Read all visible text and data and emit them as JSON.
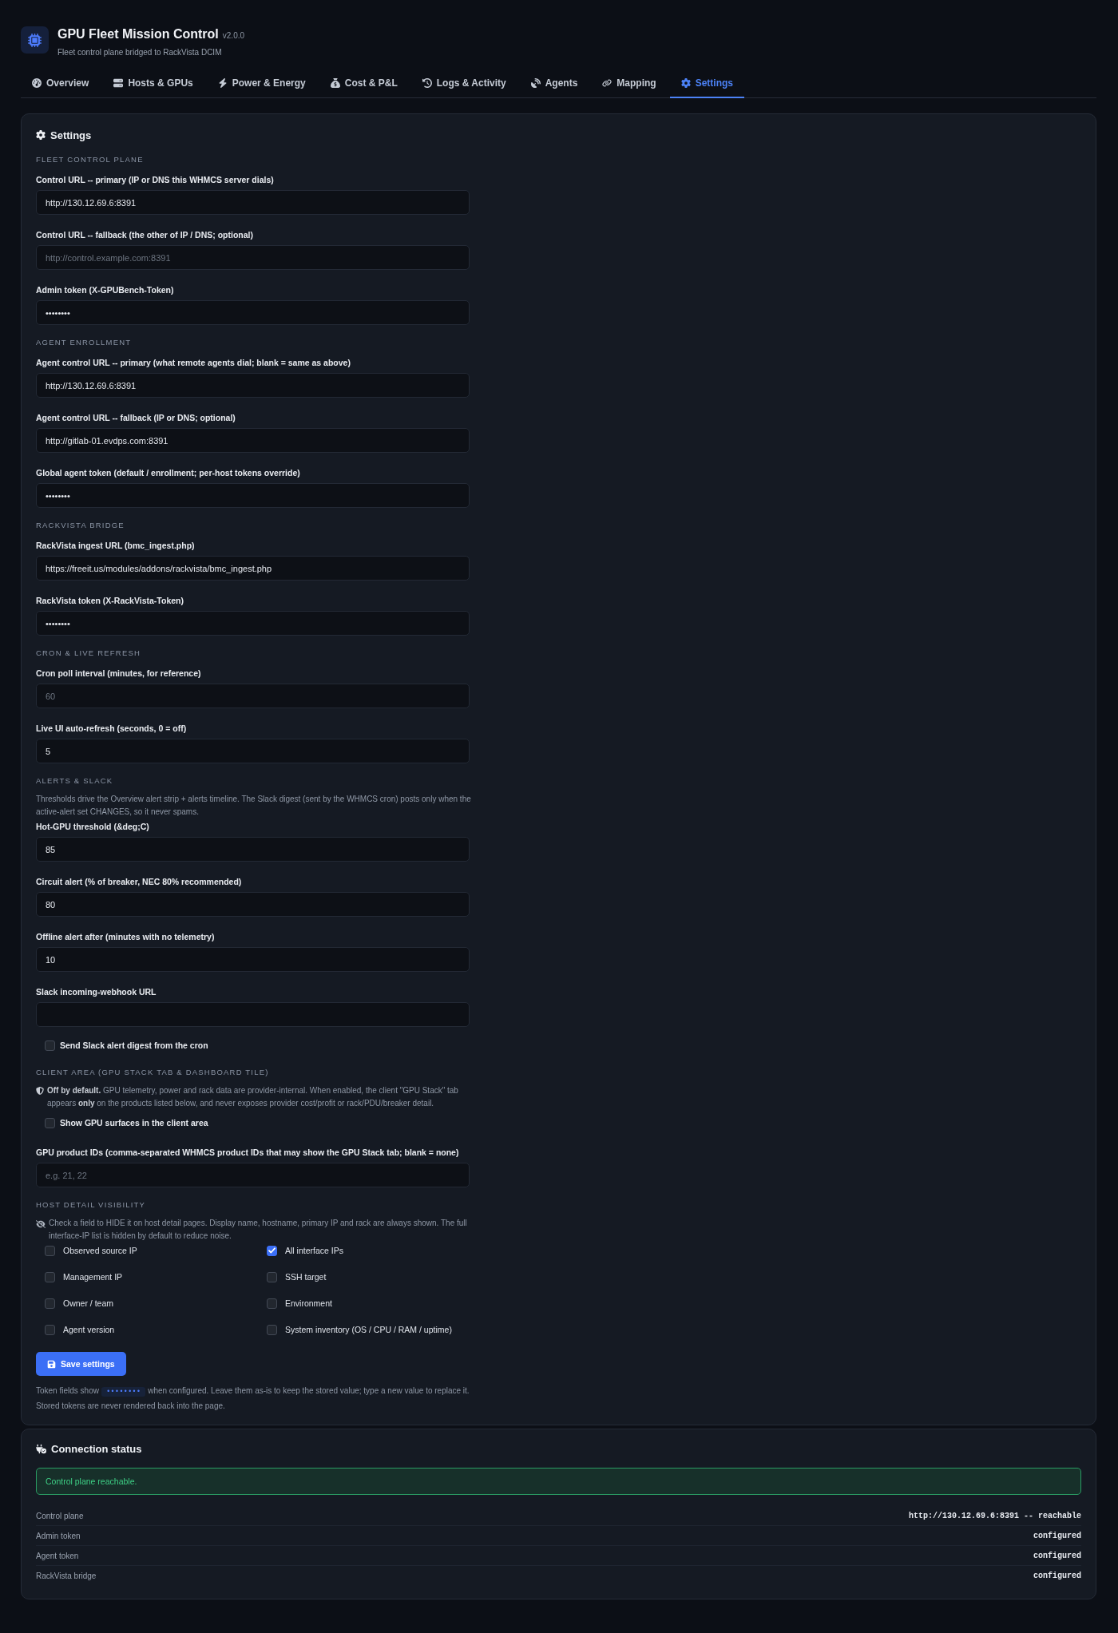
{
  "header": {
    "title": "GPU Fleet Mission Control",
    "version": "v2.0.0",
    "subtitle": "Fleet control plane bridged to RackVista DCIM"
  },
  "tabs": [
    {
      "label": "Overview",
      "selected": false
    },
    {
      "label": "Hosts & GPUs",
      "selected": false
    },
    {
      "label": "Power & Energy",
      "selected": false
    },
    {
      "label": "Cost & P&L",
      "selected": false
    },
    {
      "label": "Logs & Activity",
      "selected": false
    },
    {
      "label": "Agents",
      "selected": false
    },
    {
      "label": "Mapping",
      "selected": false
    },
    {
      "label": "Settings",
      "selected": true
    }
  ],
  "settings": {
    "title": "Settings",
    "sections": [
      {
        "heading": "FLEET CONTROL PLANE",
        "items": [
          {
            "kind": "field",
            "label": "Control URL -- primary (IP or DNS this WHMCS server dials)",
            "value": "http://130.12.69.6:8391"
          },
          {
            "kind": "field",
            "label": "Control URL -- fallback (the other of IP / DNS; optional)",
            "placeholder": "http://control.example.com:8391"
          },
          {
            "kind": "field",
            "label": "Admin token (X-GPUBench-Token)",
            "value": "••••••••"
          }
        ]
      },
      {
        "heading": "AGENT ENROLLMENT",
        "items": [
          {
            "kind": "field",
            "label": "Agent control URL -- primary (what remote agents dial; blank = same as above)",
            "value": "http://130.12.69.6:8391"
          },
          {
            "kind": "field",
            "label": "Agent control URL -- fallback (IP or DNS; optional)",
            "value": "http://gitlab-01.evdps.com:8391"
          },
          {
            "kind": "field",
            "label": "Global agent token (default / enrollment; per-host tokens override)",
            "value": "••••••••"
          }
        ]
      },
      {
        "heading": "RACKVISTA BRIDGE",
        "items": [
          {
            "kind": "field",
            "label": "RackVista ingest URL (bmc_ingest.php)",
            "value": "https://freeit.us/modules/addons/rackvista/bmc_ingest.php"
          },
          {
            "kind": "field",
            "label": "RackVista token (X-RackVista-Token)",
            "value": "••••••••"
          }
        ]
      },
      {
        "heading": "CRON & LIVE REFRESH",
        "items": [
          {
            "kind": "field",
            "label": "Cron poll interval (minutes, for reference)",
            "placeholder": "60"
          },
          {
            "kind": "field",
            "label": "Live UI auto-refresh (seconds, 0 = off)",
            "value": "5"
          }
        ]
      },
      {
        "heading": "ALERTS & SLACK",
        "items": [
          {
            "kind": "note",
            "text": "Thresholds drive the Overview alert strip + alerts timeline. The Slack digest (sent by the WHMCS cron) posts only when the active-alert set CHANGES, so it never spams."
          },
          {
            "kind": "field",
            "label": "Hot-GPU threshold (&deg;C)",
            "value": "85"
          },
          {
            "kind": "field",
            "label": "Circuit alert (% of breaker, NEC 80% recommended)",
            "value": "80"
          },
          {
            "kind": "field",
            "label": "Offline alert after (minutes with no telemetry)",
            "value": "10"
          },
          {
            "kind": "field",
            "label": "Slack incoming-webhook URL"
          },
          {
            "kind": "checkbox",
            "label": "Send Slack alert digest from the cron",
            "checked": false
          }
        ]
      },
      {
        "heading": "CLIENT AREA (GPU STACK TAB & DASHBOARD TILE)",
        "items": [
          {
            "kind": "policy",
            "text": "**Off by default.** GPU telemetry, power and rack data are provider-internal. When enabled, the client \"GPU Stack\" tab appears **only** on the products listed below, and never exposes provider cost/profit or rack/PDU/breaker detail."
          },
          {
            "kind": "checkbox",
            "label": "Show GPU surfaces in the client area",
            "checked": false
          },
          {
            "kind": "field",
            "label": "GPU product IDs (comma-separated WHMCS product IDs that may show the GPU Stack tab; blank = none)",
            "placeholder": "e.g. 21, 22"
          }
        ]
      },
      {
        "heading": "HOST DETAIL VISIBILITY",
        "items": [
          {
            "kind": "privacy",
            "text": "Check a field to HIDE it on host detail pages. Display name, hostname, primary IP and rack are always shown. The full interface-IP list is hidden by default to reduce noise."
          },
          {
            "kind": "checkgrid",
            "options": [
              {
                "label": "Observed source IP",
                "checked": false
              },
              {
                "label": "All interface IPs",
                "checked": true
              },
              {
                "label": "Management IP",
                "checked": false
              },
              {
                "label": "SSH target",
                "checked": false
              },
              {
                "label": "Owner / team",
                "checked": false
              },
              {
                "label": "Environment",
                "checked": false
              },
              {
                "label": "Agent version",
                "checked": false
              },
              {
                "label": "System inventory (OS / CPU / RAM / uptime)",
                "checked": false
              }
            ]
          }
        ]
      }
    ],
    "save_button": "Save settings",
    "token_note": {
      "before": "Token fields show",
      "code": "••••••••",
      "after": "when configured. Leave them as-is to keep the stored value; type a new value to replace it. Stored tokens are never rendered back into the page."
    }
  },
  "connection": {
    "title": "Connection status",
    "alert": "Control plane reachable.",
    "rows": [
      {
        "label": "Control plane",
        "value": "http://130.12.69.6:8391 -- reachable"
      },
      {
        "label": "Admin token",
        "value": "configured"
      },
      {
        "label": "Agent token",
        "value": "configured"
      },
      {
        "label": "RackVista bridge",
        "value": "configured"
      }
    ]
  }
}
